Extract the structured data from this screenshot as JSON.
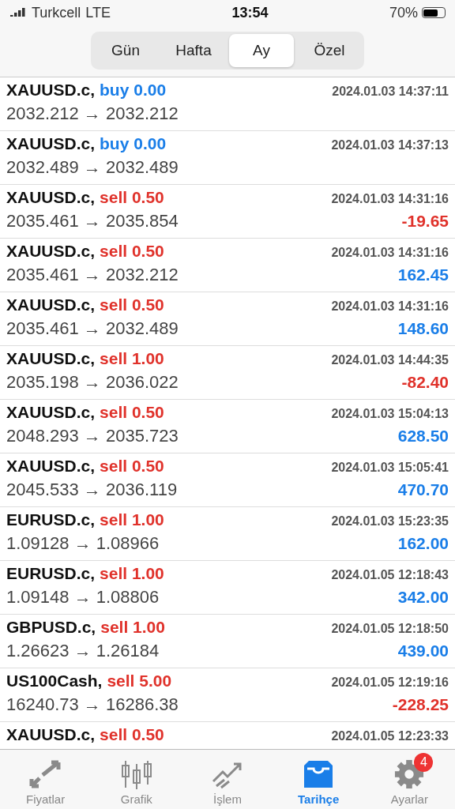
{
  "status_bar": {
    "carrier": "Turkcell",
    "network": "LTE",
    "time": "13:54",
    "battery": "70%"
  },
  "period_tabs": [
    {
      "label": "Gün",
      "selected": false
    },
    {
      "label": "Hafta",
      "selected": false
    },
    {
      "label": "Ay",
      "selected": true
    },
    {
      "label": "Özel",
      "selected": false
    }
  ],
  "deals": [
    {
      "symbol": "XAUUSD.c,",
      "buy": true,
      "volume": "buy 0.00",
      "time": "2024.01.03 14:37:11",
      "prices": "2032.212 → 2032.212"
    },
    {
      "symbol": "XAUUSD.c,",
      "buy": true,
      "volume": "buy 0.00",
      "time": "2024.01.03 14:37:13",
      "prices": "2032.489 → 2032.489"
    },
    {
      "symbol": "XAUUSD.c,",
      "buy": false,
      "volume": "sell 0.50",
      "time": "2024.01.03 14:31:16",
      "prices": "2035.461 → 2035.854",
      "profit": "-19.65",
      "loss": true
    },
    {
      "symbol": "XAUUSD.c,",
      "buy": false,
      "volume": "sell 0.50",
      "time": "2024.01.03 14:31:16",
      "prices": "2035.461 → 2032.212",
      "profit": "162.45",
      "loss": false
    },
    {
      "symbol": "XAUUSD.c,",
      "buy": false,
      "volume": "sell 0.50",
      "time": "2024.01.03 14:31:16",
      "prices": "2035.461 → 2032.489",
      "profit": "148.60",
      "loss": false
    },
    {
      "symbol": "XAUUSD.c,",
      "buy": false,
      "volume": "sell 1.00",
      "time": "2024.01.03 14:44:35",
      "prices": "2035.198 → 2036.022",
      "profit": "-82.40",
      "loss": true
    },
    {
      "symbol": "XAUUSD.c,",
      "buy": false,
      "volume": "sell 0.50",
      "time": "2024.01.03 15:04:13",
      "prices": "2048.293 → 2035.723",
      "profit": "628.50",
      "loss": false
    },
    {
      "symbol": "XAUUSD.c,",
      "buy": false,
      "volume": "sell 0.50",
      "time": "2024.01.03 15:05:41",
      "prices": "2045.533 → 2036.119",
      "profit": "470.70",
      "loss": false
    },
    {
      "symbol": "EURUSD.c,",
      "buy": false,
      "volume": "sell 1.00",
      "time": "2024.01.03 15:23:35",
      "prices": "1.09128 → 1.08966",
      "profit": "162.00",
      "loss": false
    },
    {
      "symbol": "EURUSD.c,",
      "buy": false,
      "volume": "sell 1.00",
      "time": "2024.01.05 12:18:43",
      "prices": "1.09148 → 1.08806",
      "profit": "342.00",
      "loss": false
    },
    {
      "symbol": "GBPUSD.c,",
      "buy": false,
      "volume": "sell 1.00",
      "time": "2024.01.05 12:18:50",
      "prices": "1.26623 → 1.26184",
      "profit": "439.00",
      "loss": false
    },
    {
      "symbol": "US100Cash,",
      "buy": false,
      "volume": "sell 5.00",
      "time": "2024.01.05 12:19:16",
      "prices": "16240.73 → 16286.38",
      "profit": "-228.25",
      "loss": true
    },
    {
      "symbol": "XAUUSD.c,",
      "buy": false,
      "volume": "sell 0.50",
      "time": "2024.01.05 12:23:33"
    }
  ],
  "tab_bar": [
    {
      "kind": "arrows",
      "label": "Fiyatlar",
      "selected": false
    },
    {
      "kind": "candles",
      "label": "Grafik",
      "selected": false
    },
    {
      "kind": "trend",
      "label": "İşlem",
      "selected": false
    },
    {
      "kind": "inbox",
      "label": "Tarihçe",
      "selected": true
    },
    {
      "kind": "gear",
      "label": "Ayarlar",
      "selected": false,
      "badge": "4"
    }
  ]
}
